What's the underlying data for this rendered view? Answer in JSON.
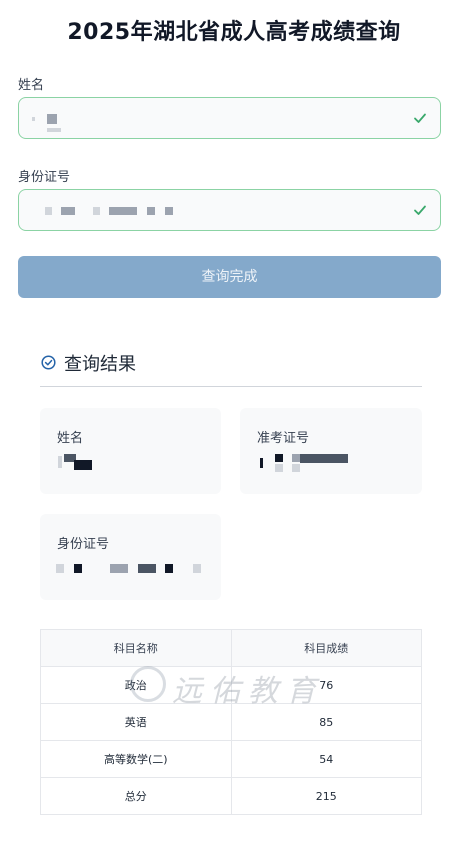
{
  "page": {
    "title": "2025年湖北省成人高考成绩查询"
  },
  "form": {
    "name_label": "姓名",
    "id_label": "身份证号",
    "submit_label": "查询完成"
  },
  "result": {
    "heading": "查询结果",
    "name_label": "姓名",
    "exam_id_label": "准考证号",
    "id_card_label": "身份证号"
  },
  "scores": {
    "headers": [
      "科目名称",
      "科目成绩"
    ],
    "rows": [
      {
        "subject": "政治",
        "score": "76"
      },
      {
        "subject": "英语",
        "score": "85"
      },
      {
        "subject": "高等数学(二)",
        "score": "54"
      },
      {
        "subject": "总分",
        "score": "215"
      }
    ]
  },
  "watermark": {
    "text": "远佑教育"
  },
  "colors": {
    "valid_border": "#8bd3a4",
    "check": "#3aa86b",
    "button": "#84a9cb",
    "accent": "#2563a8"
  }
}
